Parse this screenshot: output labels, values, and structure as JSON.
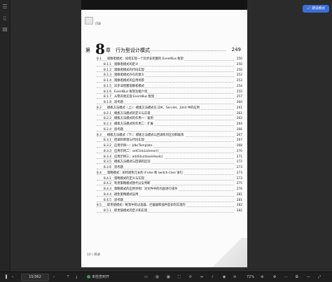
{
  "sidebar": {
    "icons": [
      "list-icon",
      "bookmark-icon",
      "note-icon"
    ]
  },
  "toolbar": {
    "read_aloud_label": "朗读模式"
  },
  "page": {
    "breadcrumb": "目录",
    "chapter": {
      "prefix": "第",
      "number": "8",
      "suffix": "章",
      "title": "行为型设计模式",
      "page": "249"
    },
    "toc": [
      {
        "num": "8.1",
        "text": "观察者模式：如何实现一个异步非阻塞的 EventBus 框架",
        "page": "250",
        "level": 1
      },
      {
        "num": "8.1.1",
        "text": "观察者模式的定义",
        "page": "250",
        "level": 2
      },
      {
        "num": "8.1.2",
        "text": "观察者模式的代码实现",
        "page": "250",
        "level": 2
      },
      {
        "num": "8.1.3",
        "text": "观察者模式存在的意义",
        "page": "252",
        "level": 2
      },
      {
        "num": "8.1.4",
        "text": "观察者模式的应用场景",
        "page": "253",
        "level": 2
      },
      {
        "num": "8.1.5",
        "text": "异步非阻塞观察者模式",
        "page": "254",
        "level": 2
      },
      {
        "num": "8.1.6",
        "text": "EventBus 框架功能介绍",
        "page": "255",
        "level": 2
      },
      {
        "num": "8.1.7",
        "text": "从零开始实现 EventBus 框架",
        "page": "257",
        "level": 2
      },
      {
        "num": "8.1.8",
        "text": "思考题",
        "page": "260",
        "level": 2
      },
      {
        "num": "8.2",
        "text": "模板方法模式（上）：模板方法模式在 JDK、Servlet、JUnit 中的应用",
        "page": "261",
        "level": 1
      },
      {
        "num": "8.2.1",
        "text": "模板方法模式的定义与实现",
        "page": "261",
        "level": 2
      },
      {
        "num": "8.2.2",
        "text": "模板方法模式的作用一：复用",
        "page": "262",
        "level": 2
      },
      {
        "num": "8.2.3",
        "text": "模板方法模式的作用二：扩展",
        "page": "264",
        "level": 2
      },
      {
        "num": "8.2.4",
        "text": "思考题",
        "page": "266",
        "level": 2
      },
      {
        "num": "8.3",
        "text": "模板方法模式（下）：模板方法模式与回调有何区别和联系",
        "page": "267",
        "level": 1
      },
      {
        "num": "8.3.1",
        "text": "回调的原理与代码实现",
        "page": "267",
        "level": 2
      },
      {
        "num": "8.3.2",
        "text": "应用示例一：JdbcTemplate",
        "page": "268",
        "level": 2
      },
      {
        "num": "8.3.3",
        "text": "应用示例二：setClickListener()",
        "page": "270",
        "level": 2
      },
      {
        "num": "8.3.4",
        "text": "应用示例三：addShutdownHook()",
        "page": "271",
        "level": 2
      },
      {
        "num": "8.3.5",
        "text": "模板方法模式与回调的区别",
        "page": "272",
        "level": 2
      },
      {
        "num": "8.3.6",
        "text": "思考题",
        "page": "273",
        "level": 2
      },
      {
        "num": "8.4",
        "text": "策略模式：如何避免冗长的 if-else 和 switch-case 语句",
        "page": "273",
        "level": 1
      },
      {
        "num": "8.4.1",
        "text": "策略模式的定义与实现",
        "page": "273",
        "level": 2
      },
      {
        "num": "8.4.2",
        "text": "利用策略模式替代分支判断",
        "page": "275",
        "level": 2
      },
      {
        "num": "8.4.3",
        "text": "策略模式的应用举例：对文件中的内容进行排序",
        "page": "276",
        "level": 2
      },
      {
        "num": "8.4.4",
        "text": "避免策略模式误用",
        "page": "281",
        "level": 2
      },
      {
        "num": "8.4.5",
        "text": "思考题",
        "page": "281",
        "level": 2
      },
      {
        "num": "8.5",
        "text": "职责链模式：框架中的过滤器、拦截器和插件是如何实现的",
        "page": "282",
        "level": 1
      },
      {
        "num": "8.5.1",
        "text": "职责链模式的定义和实现",
        "page": "282",
        "level": 2
      }
    ],
    "footer": "10 \\ 目录"
  },
  "bottom_bar": {
    "page_indicator": "15/362",
    "status_text": "未检查到开",
    "zoom": "72%"
  }
}
